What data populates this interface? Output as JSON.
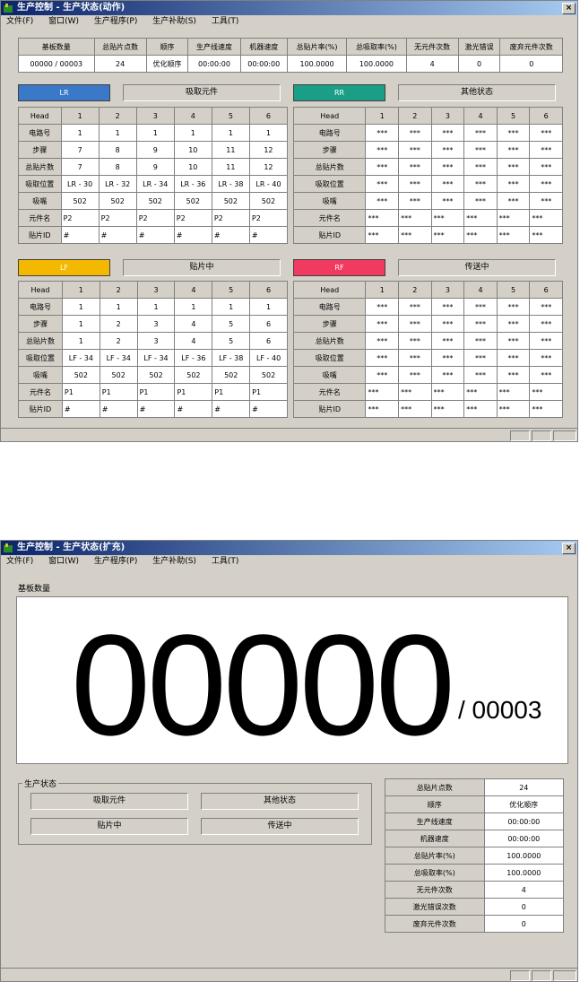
{
  "window1": {
    "title": "生产控制  - 生产状态(动作)",
    "menu": [
      "文件(F)",
      "窗口(W)",
      "生产程序(P)",
      "生产补助(S)",
      "工具(T)"
    ],
    "summary": {
      "headers": [
        "基板数量",
        "总贴片点数",
        "顺序",
        "生产线速度",
        "机器速度",
        "总贴片率(%)",
        "总吸取率(%)",
        "无元件次数",
        "激光错误",
        "废弃元件次数"
      ],
      "values": [
        "00000 / 00003",
        "24",
        "优化顺序",
        "00:00:00",
        "00:00:00",
        "100.0000",
        "100.0000",
        "4",
        "0",
        "0"
      ]
    },
    "panels": {
      "LR": {
        "label": "LR",
        "color": "#3a78c8",
        "status": "吸取元件",
        "heads": [
          "Head",
          "1",
          "2",
          "3",
          "4",
          "5",
          "6"
        ],
        "rows": [
          [
            "电路号",
            "1",
            "1",
            "1",
            "1",
            "1",
            "1"
          ],
          [
            "步骤",
            "7",
            "8",
            "9",
            "10",
            "11",
            "12"
          ],
          [
            "总贴片数",
            "7",
            "8",
            "9",
            "10",
            "11",
            "12"
          ],
          [
            "吸取位置",
            "LR - 30",
            "LR - 32",
            "LR - 34",
            "LR - 36",
            "LR - 38",
            "LR - 40"
          ],
          [
            "吸嘴",
            "502",
            "502",
            "502",
            "502",
            "502",
            "502"
          ],
          [
            "元件名",
            "P2",
            "P2",
            "P2",
            "P2",
            "P2",
            "P2"
          ],
          [
            "贴片ID",
            "#",
            "#",
            "#",
            "#",
            "#",
            "#"
          ]
        ]
      },
      "RR": {
        "label": "RR",
        "color": "#1a9e86",
        "status": "其他状态",
        "heads": [
          "Head",
          "1",
          "2",
          "3",
          "4",
          "5",
          "6"
        ],
        "rows": [
          [
            "电路号",
            "***",
            "***",
            "***",
            "***",
            "***",
            "***"
          ],
          [
            "步骤",
            "***",
            "***",
            "***",
            "***",
            "***",
            "***"
          ],
          [
            "总贴片数",
            "***",
            "***",
            "***",
            "***",
            "***",
            "***"
          ],
          [
            "吸取位置",
            "***",
            "***",
            "***",
            "***",
            "***",
            "***"
          ],
          [
            "吸嘴",
            "***",
            "***",
            "***",
            "***",
            "***",
            "***"
          ],
          [
            "元件名",
            "***",
            "***",
            "***",
            "***",
            "***",
            "***"
          ],
          [
            "贴片ID",
            "***",
            "***",
            "***",
            "***",
            "***",
            "***"
          ]
        ]
      },
      "LF": {
        "label": "LF",
        "color": "#f4b800",
        "status": "贴片中",
        "heads": [
          "Head",
          "1",
          "2",
          "3",
          "4",
          "5",
          "6"
        ],
        "rows": [
          [
            "电路号",
            "1",
            "1",
            "1",
            "1",
            "1",
            "1"
          ],
          [
            "步骤",
            "1",
            "2",
            "3",
            "4",
            "5",
            "6"
          ],
          [
            "总贴片数",
            "1",
            "2",
            "3",
            "4",
            "5",
            "6"
          ],
          [
            "吸取位置",
            "LF - 34",
            "LF - 34",
            "LF - 34",
            "LF - 36",
            "LF - 38",
            "LF - 40"
          ],
          [
            "吸嘴",
            "502",
            "502",
            "502",
            "502",
            "502",
            "502"
          ],
          [
            "元件名",
            "P1",
            "P1",
            "P1",
            "P1",
            "P1",
            "P1"
          ],
          [
            "贴片ID",
            "#",
            "#",
            "#",
            "#",
            "#",
            "#"
          ]
        ]
      },
      "RF": {
        "label": "RF",
        "color": "#f03a5f",
        "status": "传送中",
        "heads": [
          "Head",
          "1",
          "2",
          "3",
          "4",
          "5",
          "6"
        ],
        "rows": [
          [
            "电路号",
            "***",
            "***",
            "***",
            "***",
            "***",
            "***"
          ],
          [
            "步骤",
            "***",
            "***",
            "***",
            "***",
            "***",
            "***"
          ],
          [
            "总贴片数",
            "***",
            "***",
            "***",
            "***",
            "***",
            "***"
          ],
          [
            "吸取位置",
            "***",
            "***",
            "***",
            "***",
            "***",
            "***"
          ],
          [
            "吸嘴",
            "***",
            "***",
            "***",
            "***",
            "***",
            "***"
          ],
          [
            "元件名",
            "***",
            "***",
            "***",
            "***",
            "***",
            "***"
          ],
          [
            "贴片ID",
            "***",
            "***",
            "***",
            "***",
            "***",
            "***"
          ]
        ]
      }
    }
  },
  "window2": {
    "title": "生产控制  - 生产状态(扩充)",
    "menu": [
      "文件(F)",
      "窗口(W)",
      "生产程序(P)",
      "生产补助(S)",
      "工具(T)"
    ],
    "board_label": "基板数量",
    "board_count": "00000",
    "board_total": "/ 00003",
    "group_label": "生产状态",
    "states": [
      "吸取元件",
      "其他状态",
      "贴片中",
      "传送中"
    ],
    "stats": [
      [
        "总贴片点数",
        "24"
      ],
      [
        "顺序",
        "优化顺序"
      ],
      [
        "生产线速度",
        "00:00:00"
      ],
      [
        "机器速度",
        "00:00:00"
      ],
      [
        "总贴片率(%)",
        "100.0000"
      ],
      [
        "总吸取率(%)",
        "100.0000"
      ],
      [
        "无元件次数",
        "4"
      ],
      [
        "激光错误次数",
        "0"
      ],
      [
        "废弃元件次数",
        "0"
      ]
    ]
  }
}
